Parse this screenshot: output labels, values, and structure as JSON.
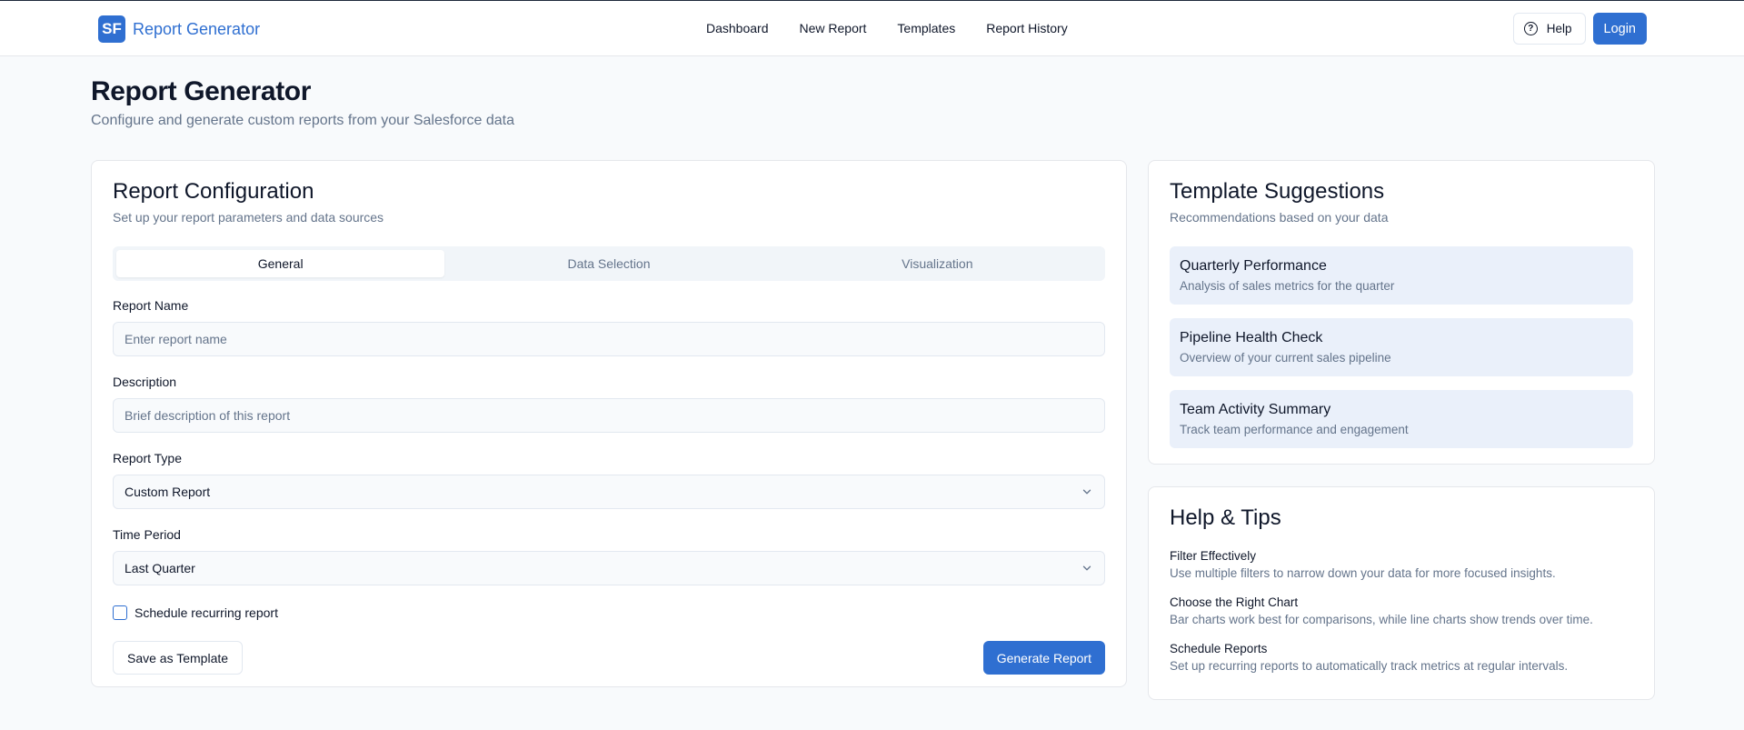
{
  "header": {
    "logo_text": "SF",
    "brand_name": "Report Generator",
    "nav": [
      "Dashboard",
      "New Report",
      "Templates",
      "Report History"
    ],
    "help_label": "Help",
    "login_label": "Login"
  },
  "page": {
    "title": "Report Generator",
    "subtitle": "Configure and generate custom reports from your Salesforce data"
  },
  "config": {
    "title": "Report Configuration",
    "description": "Set up your report parameters and data sources",
    "tabs": [
      {
        "label": "General",
        "active": true
      },
      {
        "label": "Data Selection",
        "active": false
      },
      {
        "label": "Visualization",
        "active": false
      }
    ],
    "report_name_label": "Report Name",
    "report_name_placeholder": "Enter report name",
    "description_label": "Description",
    "description_placeholder": "Brief description of this report",
    "report_type_label": "Report Type",
    "report_type_value": "Custom Report",
    "time_period_label": "Time Period",
    "time_period_value": "Last Quarter",
    "schedule_label": "Schedule recurring report",
    "schedule_checked": false,
    "save_template_label": "Save as Template",
    "generate_label": "Generate Report"
  },
  "templates": {
    "title": "Template Suggestions",
    "description": "Recommendations based on your data",
    "items": [
      {
        "name": "Quarterly Performance",
        "desc": "Analysis of sales metrics for the quarter"
      },
      {
        "name": "Pipeline Health Check",
        "desc": "Overview of your current sales pipeline"
      },
      {
        "name": "Team Activity Summary",
        "desc": "Track team performance and engagement"
      }
    ]
  },
  "help": {
    "title": "Help & Tips",
    "tips": [
      {
        "title": "Filter Effectively",
        "text": "Use multiple filters to narrow down your data for more focused insights."
      },
      {
        "title": "Choose the Right Chart",
        "text": "Bar charts work best for comparisons, while line charts show trends over time."
      },
      {
        "title": "Schedule Reports",
        "text": "Set up recurring reports to automatically track metrics at regular intervals."
      }
    ]
  },
  "colors": {
    "brand": "#2f6fd1",
    "template_bg": "#eaf0fa",
    "muted_text": "#64748b"
  }
}
